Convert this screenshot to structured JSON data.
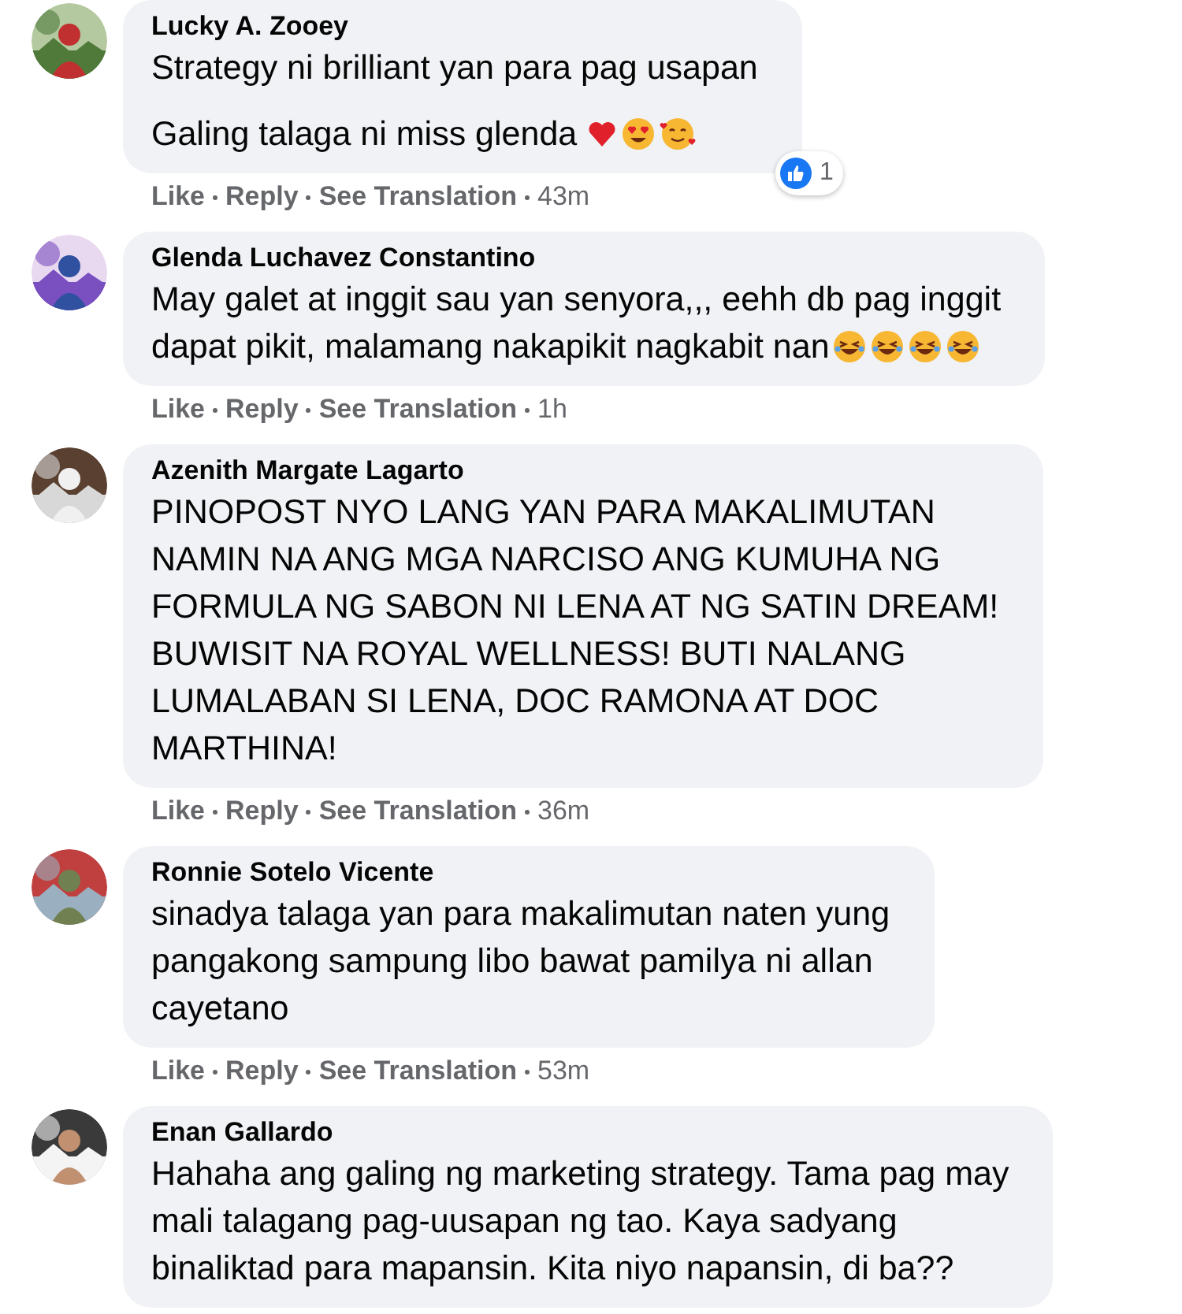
{
  "comments": [
    {
      "author": "Lucky A. Zooey",
      "paragraphs": [
        [
          "Strategy ni brilliant yan para pag usapan"
        ],
        [
          "Galing talaga ni miss glenda"
        ]
      ],
      "emojis": [
        {
          "kind": "heart"
        },
        {
          "kind": "heart-eyes"
        },
        {
          "kind": "smiling-hearts"
        }
      ],
      "reaction": {
        "count": "1"
      },
      "actions": [
        "Like",
        "Reply",
        "See Translation",
        "43m"
      ]
    },
    {
      "author": "Glenda Luchavez Constantino",
      "paragraphs": [
        [
          "May galet at inggit sau yan senyora,,, eehh db pag inggit",
          "dapat pikit, malamang nakapikit nagkabit nan"
        ]
      ],
      "emojis": [
        {
          "kind": "laughing"
        },
        {
          "kind": "laughing"
        },
        {
          "kind": "laughing"
        },
        {
          "kind": "laughing"
        }
      ],
      "actions": [
        "Like",
        "Reply",
        "See Translation",
        "1h"
      ]
    },
    {
      "author": "Azenith Margate Lagarto",
      "paragraphs": [
        [
          "PINOPOST NYO LANG YAN PARA MAKALIMUTAN",
          "NAMIN NA ANG MGA NARCISO ANG KUMUHA NG",
          "FORMULA NG SABON NI LENA AT NG SATIN DREAM!",
          "BUWISIT NA ROYAL WELLNESS! BUTI NALANG",
          "LUMALABAN SI LENA, DOC RAMONA AT DOC",
          "MARTHINA!"
        ]
      ],
      "actions": [
        "Like",
        "Reply",
        "See Translation",
        "36m"
      ]
    },
    {
      "author": "Ronnie Sotelo Vicente",
      "paragraphs": [
        [
          "sinadya talaga yan para makalimutan naten yung",
          "pangakong sampung libo bawat pamilya ni allan",
          "cayetano"
        ]
      ],
      "actions": [
        "Like",
        "Reply",
        "See Translation",
        "53m"
      ]
    },
    {
      "author": "Enan Gallardo",
      "paragraphs": [
        [
          "Hahaha ang galing ng marketing strategy. Tama pag may",
          "mali talagang pag-uusapan ng tao. Kaya sadyang",
          "binaliktad para mapansin. Kita niyo napansin, di ba??"
        ]
      ]
    }
  ]
}
